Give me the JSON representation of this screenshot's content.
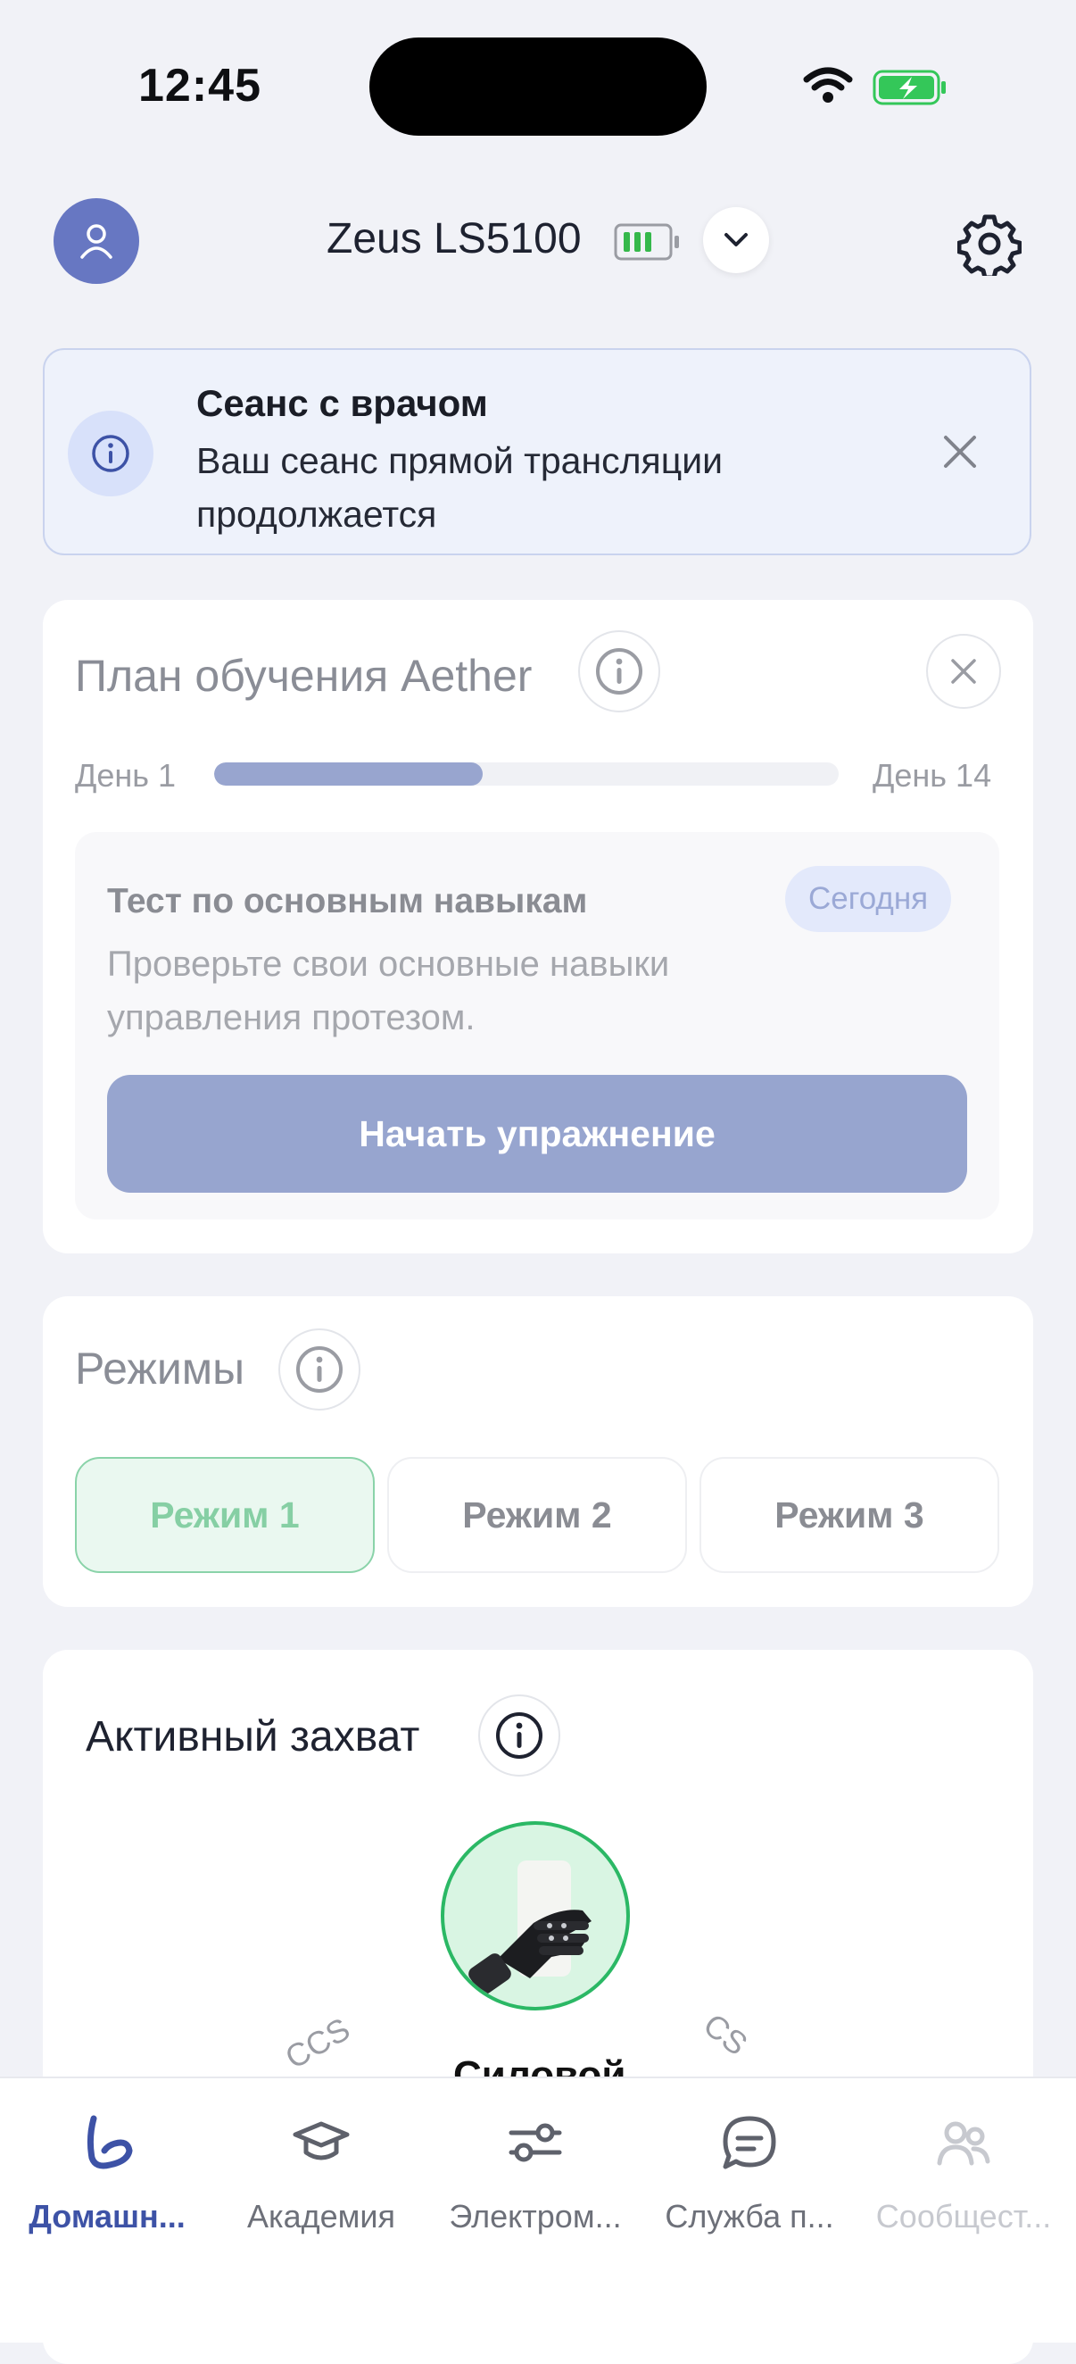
{
  "status": {
    "time": "12:45"
  },
  "header": {
    "device_name": "Zeus LS5100"
  },
  "banner": {
    "title": "Сеанс с врачом",
    "text": "Ваш сеанс прямой трансляции продолжается"
  },
  "plan": {
    "title": "План обучения Aether",
    "day_start": "День 1",
    "day_end": "День 14",
    "progress": 0.43,
    "task": {
      "title": "Тест по основным навыкам",
      "badge": "Сегодня",
      "description": "Проверьте свои основные навыки управления протезом.",
      "button": "Начать упражнение"
    }
  },
  "modes": {
    "title": "Режимы",
    "items": [
      "Режим 1",
      "Режим 2",
      "Режим 3"
    ],
    "active_index": 0
  },
  "grip": {
    "title": "Активный захват",
    "name": "Силовой",
    "left_label": "CCS",
    "right_label": "CS"
  },
  "nav": {
    "items": [
      {
        "label": "Домашн...",
        "icon": "home-arm-icon",
        "state": "active"
      },
      {
        "label": "Академия",
        "icon": "graduation-cap-icon",
        "state": "normal"
      },
      {
        "label": "Электром...",
        "icon": "sliders-icon",
        "state": "normal"
      },
      {
        "label": "Служба п...",
        "icon": "chat-icon",
        "state": "normal"
      },
      {
        "label": "Сообщест...",
        "icon": "community-icon",
        "state": "disabled"
      }
    ]
  },
  "colors": {
    "accent": "#3d52a6",
    "progress": "#98a5cf",
    "active_mode": "#86cfa4",
    "grip_ring": "#2bb865"
  }
}
